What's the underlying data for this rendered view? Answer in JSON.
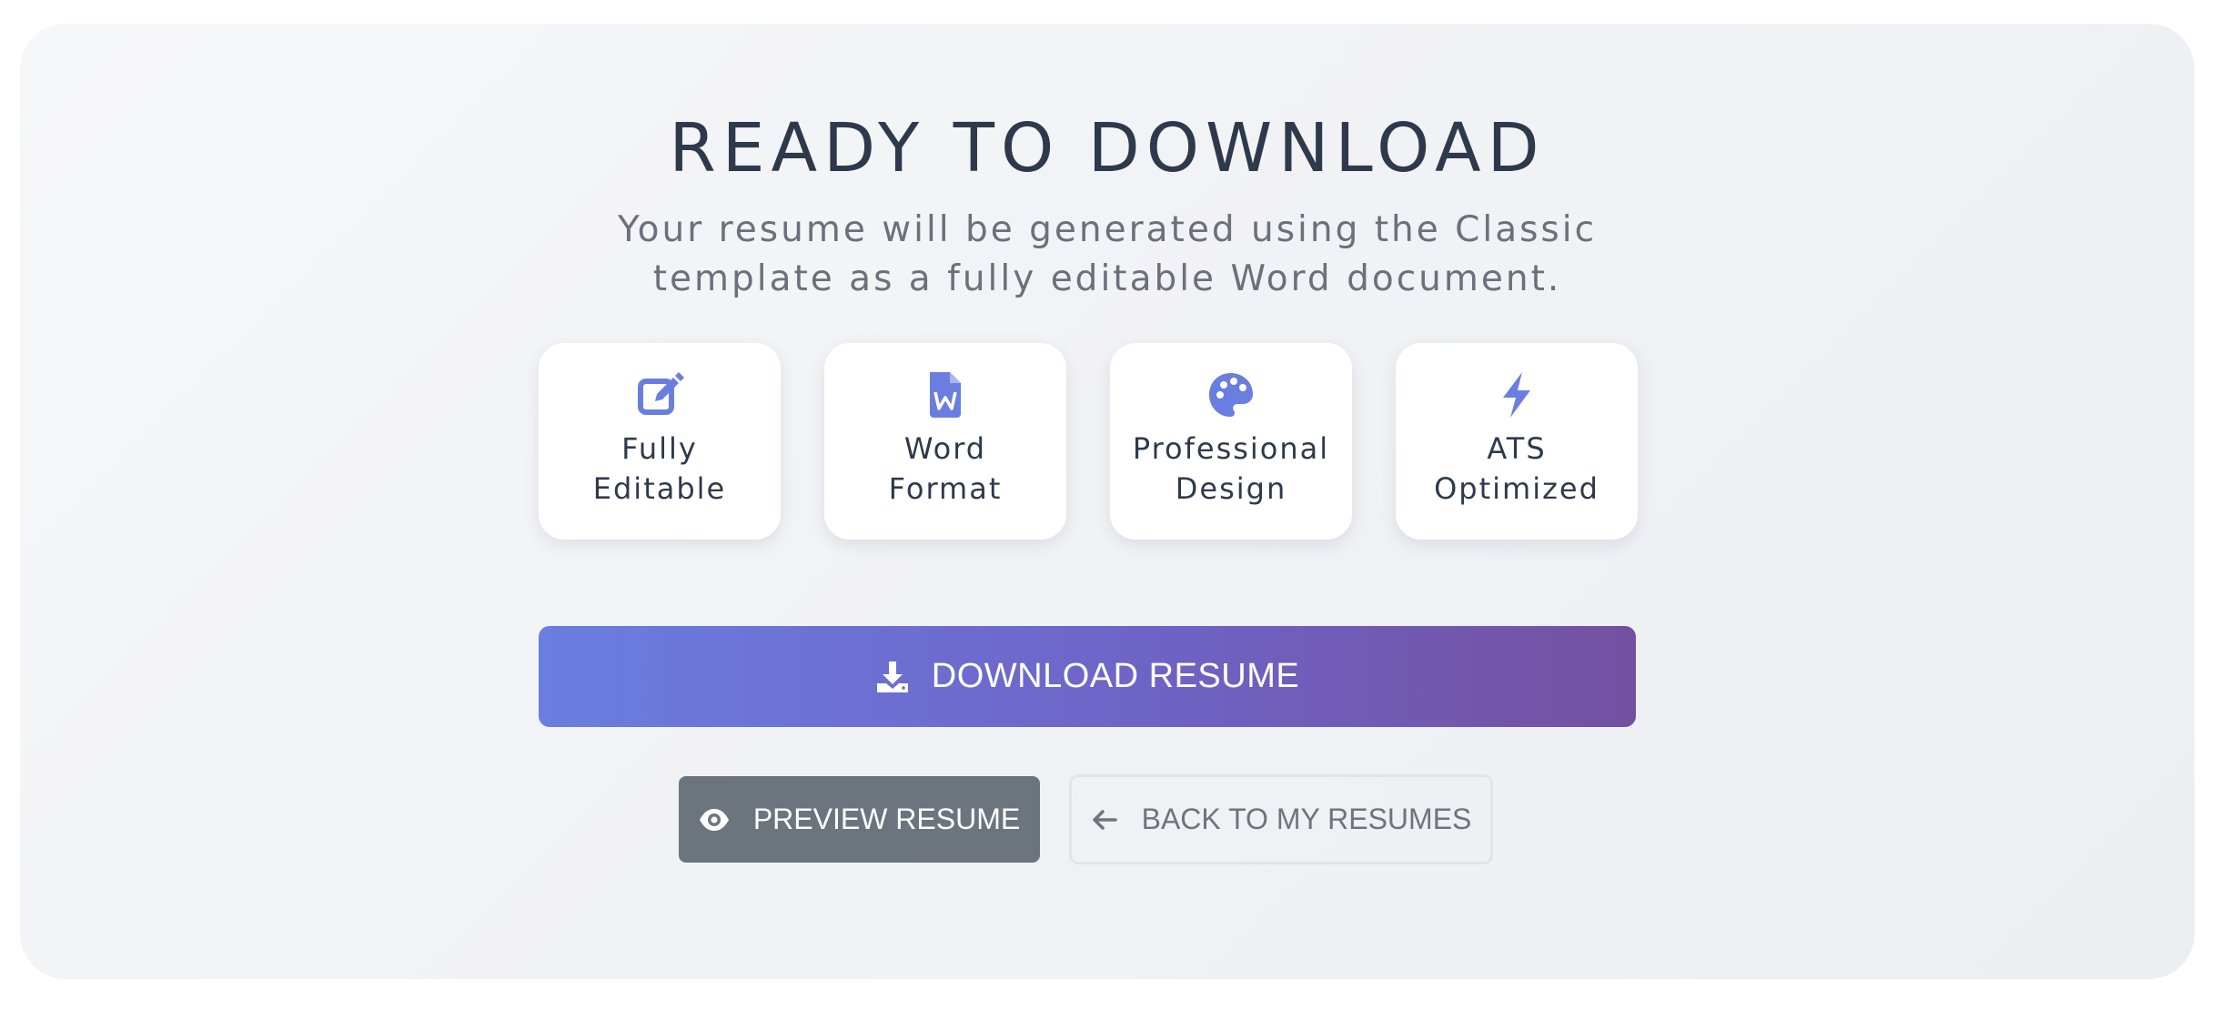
{
  "header": {
    "title": "READY TO DOWNLOAD",
    "subtitle": "Your resume will be generated using the Classic template as a fully editable Word document."
  },
  "features": [
    {
      "icon": "edit-icon",
      "label": "Fully\nEditable"
    },
    {
      "icon": "word-file-icon",
      "label": "Word\nFormat"
    },
    {
      "icon": "palette-icon",
      "label": "Professional\nDesign"
    },
    {
      "icon": "bolt-icon",
      "label": "ATS\nOptimized"
    }
  ],
  "actions": {
    "download_label": "DOWNLOAD RESUME",
    "preview_label": "PREVIEW RESUME",
    "back_label": "BACK TO MY RESUMES"
  },
  "colors": {
    "accent": "#6a7ee0",
    "accent_end": "#7450a0",
    "title": "#2e3a4b",
    "secondary_button": "#6c757d"
  }
}
